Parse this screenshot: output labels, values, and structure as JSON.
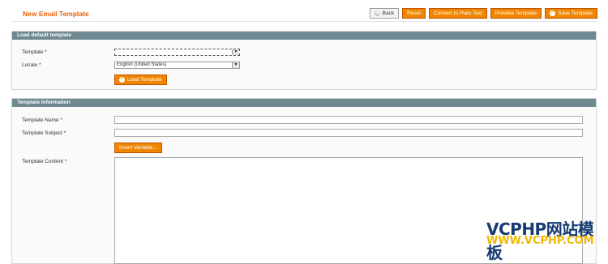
{
  "header": {
    "title": "New Email Template",
    "buttons": {
      "back": "Back",
      "reset": "Reset",
      "convert": "Convert to Plain Text",
      "preview": "Preview Template",
      "save": "Save Template"
    }
  },
  "load_section": {
    "title": "Load default template",
    "template_label": "Template *",
    "template_value": "",
    "locale_label": "Locale *",
    "locale_value": "English (United States)",
    "load_button": "Load Template"
  },
  "info_section": {
    "title": "Template Information",
    "name_label": "Template Name *",
    "name_value": "",
    "subject_label": "Template Subject *",
    "subject_value": "",
    "insert_variable_button": "Insert Variable...",
    "content_label": "Template Content *",
    "content_value": ""
  },
  "watermark": {
    "line1": "VCPHP网站模板",
    "line2": "WWW.VCPHP.COM"
  }
}
